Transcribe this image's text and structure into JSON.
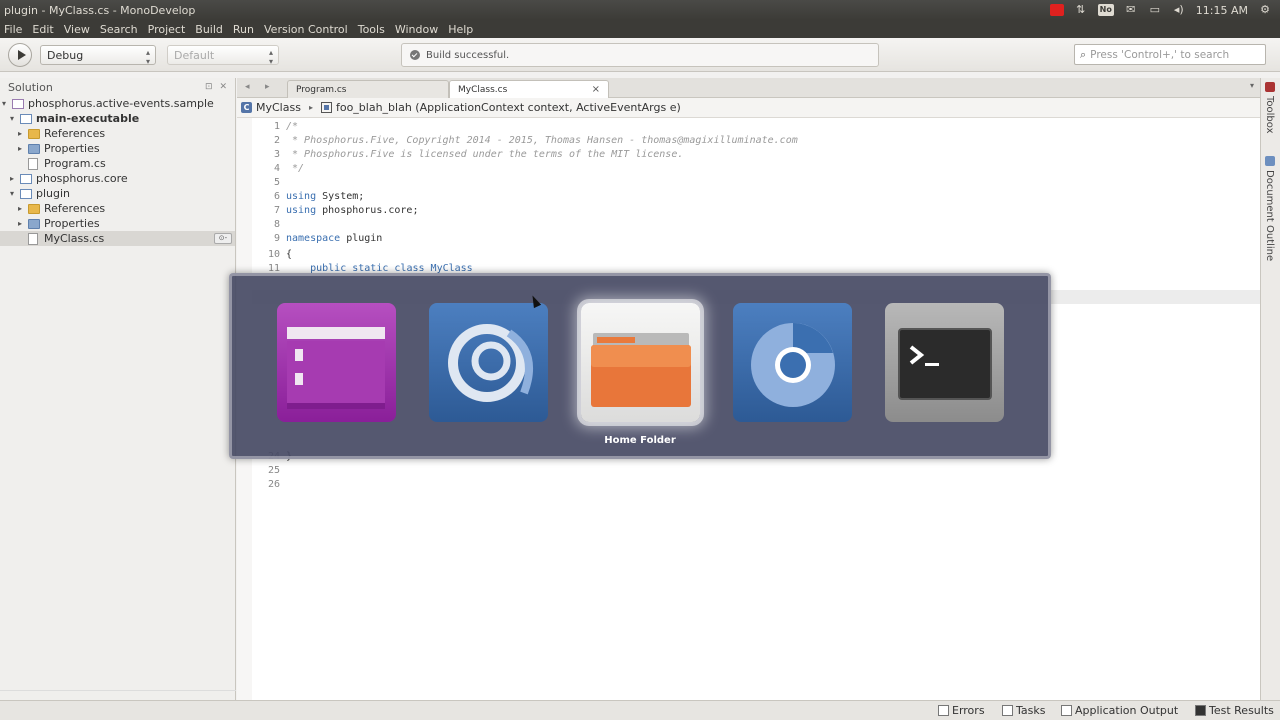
{
  "window": {
    "title": "plugin - MyClass.cs - MonoDevelop",
    "clock": "11:15 AM",
    "tray_icons": [
      "record-icon",
      "network-icon",
      "keyboard-icon",
      "mail-icon",
      "battery-icon",
      "volume-icon"
    ],
    "keyboard_label": "No"
  },
  "menu": [
    "File",
    "Edit",
    "View",
    "Search",
    "Project",
    "Build",
    "Run",
    "Version Control",
    "Tools",
    "Window",
    "Help"
  ],
  "toolbar": {
    "config": "Debug",
    "platform": "Default",
    "status": "Build successful.",
    "search_placeholder": "Press 'Control+,' to search"
  },
  "solution": {
    "header": "Solution",
    "tree": [
      {
        "label": "phosphorus.active-events.sample",
        "indent": 0,
        "icon": "solution-icon",
        "arrow": "▾",
        "bold": false
      },
      {
        "label": "main-executable",
        "indent": 1,
        "icon": "project-icon",
        "arrow": "▾",
        "bold": true
      },
      {
        "label": "References",
        "indent": 2,
        "icon": "folder-icon",
        "arrow": "▸",
        "bold": false
      },
      {
        "label": "Properties",
        "indent": 2,
        "icon": "properties-folder-icon",
        "arrow": "▸",
        "bold": false
      },
      {
        "label": "Program.cs",
        "indent": 2,
        "icon": "file-icon",
        "arrow": "",
        "bold": false
      },
      {
        "label": "phosphorus.core",
        "indent": 1,
        "icon": "project-icon",
        "arrow": "▸",
        "bold": false
      },
      {
        "label": "plugin",
        "indent": 1,
        "icon": "project-icon",
        "arrow": "▾",
        "bold": false
      },
      {
        "label": "References",
        "indent": 2,
        "icon": "folder-icon",
        "arrow": "▸",
        "bold": false
      },
      {
        "label": "Properties",
        "indent": 2,
        "icon": "properties-folder-icon",
        "arrow": "▸",
        "bold": false
      },
      {
        "label": "MyClass.cs",
        "indent": 2,
        "icon": "file-icon",
        "arrow": "",
        "bold": false
      }
    ]
  },
  "tabs": [
    "Program.cs",
    "MyClass.cs"
  ],
  "pathbar": {
    "class": "MyClass",
    "method": "foo_blah_blah (ApplicationContext context, ActiveEventArgs e)"
  },
  "code": [
    {
      "n": "1",
      "t": "/*",
      "c": "cm"
    },
    {
      "n": "2",
      "t": " * Phosphorus.Five, Copyright 2014 - 2015, Thomas Hansen - thomas@magixilluminate.com",
      "c": "cm"
    },
    {
      "n": "3",
      "t": " * Phosphorus.Five is licensed under the terms of the MIT license.",
      "c": "cm"
    },
    {
      "n": "4",
      "t": " */",
      "c": "cm"
    },
    {
      "n": "5",
      "t": "",
      "c": ""
    },
    {
      "n": "6",
      "t": "using System;",
      "c": "using"
    },
    {
      "n": "7",
      "t": "using phosphorus.core;",
      "c": "using"
    },
    {
      "n": "8",
      "t": "",
      "c": ""
    },
    {
      "n": "9",
      "t": "namespace plugin",
      "c": "ns"
    },
    {
      "n": "10",
      "t": "{",
      "c": ""
    },
    {
      "n": "11",
      "t": "    public static class MyClass",
      "c": "cls"
    },
    {
      "n": "24",
      "t": "}",
      "c": ""
    },
    {
      "n": "25",
      "t": "",
      "c": ""
    },
    {
      "n": "26",
      "t": "",
      "c": ""
    }
  ],
  "switcher": {
    "apps": [
      {
        "name": "files-manager-icon",
        "color": "#9c2fa6"
      },
      {
        "name": "eclipse-like-icon",
        "color": "#3c6aa6"
      },
      {
        "name": "home-folder-icon",
        "color": "#e7e7e7"
      },
      {
        "name": "chromium-icon",
        "color": "#3b6fb0"
      },
      {
        "name": "terminal-icon",
        "color": "#6b6b6b"
      }
    ],
    "selected_label": "Home Folder"
  },
  "right_dock": [
    "Toolbox",
    "Document Outline"
  ],
  "bottom": [
    "Errors",
    "Tasks",
    "Application Output",
    "Test Results"
  ]
}
